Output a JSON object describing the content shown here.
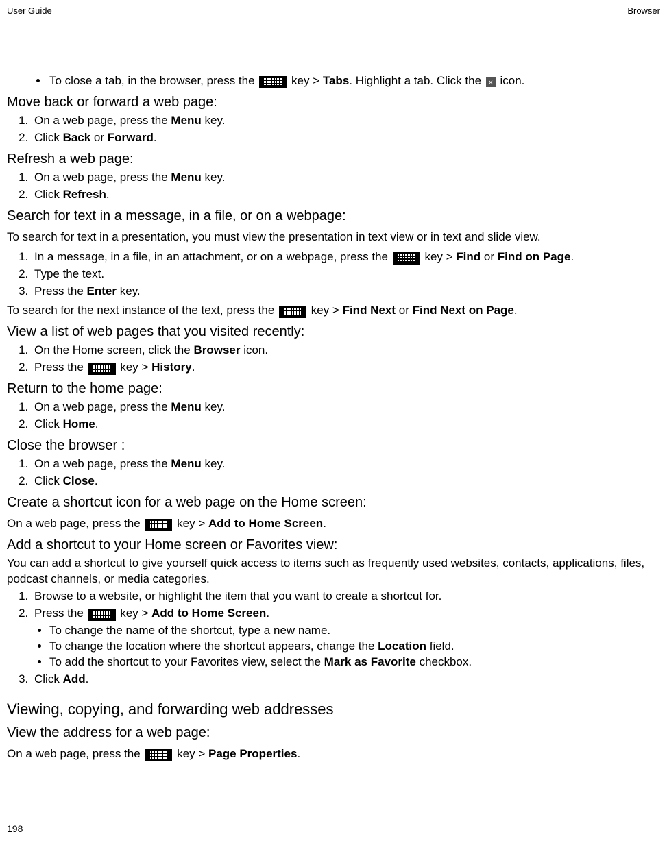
{
  "header": {
    "left": "User Guide",
    "right": "Browser"
  },
  "close_tab_bullet": {
    "p1": "To close a tab, in the browser, press the ",
    "p2": " key > ",
    "tabs": "Tabs",
    "p3": ". Highlight a tab. Click the ",
    "p4": " icon."
  },
  "move": {
    "title": "Move back or forward a web page:",
    "s1a": "On a web page, press the ",
    "s1b": "Menu",
    "s1c": " key.",
    "s2a": "Click ",
    "s2b": "Back",
    "s2c": " or ",
    "s2d": "Forward",
    "s2e": "."
  },
  "refresh": {
    "title": "Refresh a web page:",
    "s1a": "On a web page, press the ",
    "s1b": "Menu",
    "s1c": " key.",
    "s2a": "Click ",
    "s2b": "Refresh",
    "s2c": "."
  },
  "search": {
    "title": "Search for text in a message, in a file, or on a webpage:",
    "intro": "To search for text in a presentation, you must view the presentation in text view or in text and slide view.",
    "s1a": "In a message, in a file, in an attachment, or on a webpage, press the ",
    "s1b": " key > ",
    "s1c": "Find",
    "s1d": " or ",
    "s1e": "Find on Page",
    "s1f": ".",
    "s2": "Type the text.",
    "s3a": "Press the ",
    "s3b": "Enter",
    "s3c": " key.",
    "nexta": "To search for the next instance of the text, press the ",
    "nextb": " key > ",
    "nextc": "Find Next",
    "nextd": " or ",
    "nexte": "Find Next on Page",
    "nextf": "."
  },
  "history": {
    "title": "View a list of web pages that you visited recently:",
    "s1a": "On the Home screen, click the ",
    "s1b": "Browser",
    "s1c": " icon.",
    "s2a": "Press the ",
    "s2b": " key > ",
    "s2c": "History",
    "s2d": "."
  },
  "home": {
    "title": "Return to the home page:",
    "s1a": "On a web page, press the ",
    "s1b": "Menu",
    "s1c": " key.",
    "s2a": "Click ",
    "s2b": "Home",
    "s2c": "."
  },
  "close": {
    "title": "Close the browser :",
    "s1a": "On a web page, press the ",
    "s1b": "Menu",
    "s1c": " key.",
    "s2a": "Click ",
    "s2b": "Close",
    "s2c": "."
  },
  "shortcut_icon": {
    "title": "Create a shortcut icon for a web page on the Home screen:",
    "pa": "On a web page, press the ",
    "pb": " key > ",
    "pc": "Add to Home Screen",
    "pd": "."
  },
  "shortcut_fav": {
    "title": "Add a shortcut to your Home screen or Favorites view:",
    "intro": "You can add a shortcut to give yourself quick access to items such as frequently used websites, contacts, applications, files, podcast channels, or media categories.",
    "s1": "Browse to a website, or highlight the item that you want to create a shortcut for.",
    "s2a": "Press the ",
    "s2b": " key > ",
    "s2c": "Add to Home Screen",
    "s2d": ".",
    "b1": "To change the name of the shortcut, type a new name.",
    "b2a": "To change the location where the shortcut appears, change the ",
    "b2b": "Location",
    "b2c": " field.",
    "b3a": "To add the shortcut to your Favorites view, select the ",
    "b3b": "Mark as Favorite",
    "b3c": " checkbox.",
    "s3a": "Click ",
    "s3b": "Add",
    "s3c": "."
  },
  "viewing": {
    "heading": "Viewing, copying, and forwarding web addresses",
    "subtitle": "View the address for a web page:",
    "pa": "On a web page, press the ",
    "pb": " key > ",
    "pc": "Page Properties",
    "pd": "."
  },
  "page_number": "198"
}
